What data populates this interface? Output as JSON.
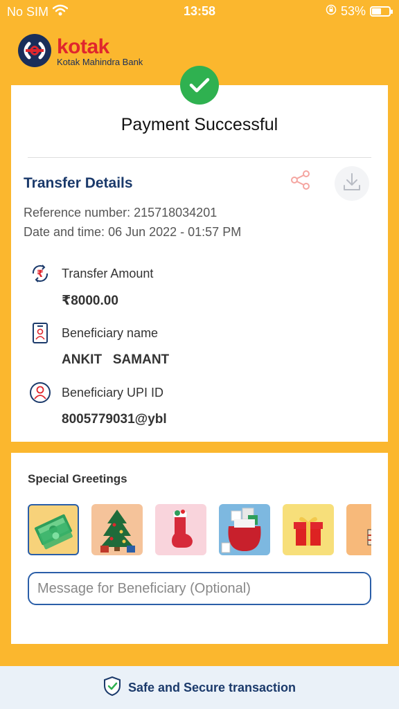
{
  "status": {
    "carrier": "No SIM",
    "time": "13:58",
    "battery": "53%",
    "battery_level": 0.53
  },
  "brand": {
    "name": "kotak",
    "subtitle": "Kotak Mahindra Bank",
    "color": "#E0262D"
  },
  "payment": {
    "status_title": "Payment Successful",
    "section_title": "Transfer Details",
    "reference": "Reference number: 215718034201",
    "datetime": "Date and time: 06 Jun 2022 - 01:57 PM",
    "details": [
      {
        "icon": "rupee-transfer-icon",
        "label": "Transfer Amount",
        "value": "₹8000.00"
      },
      {
        "icon": "id-card-icon",
        "label": "Beneficiary name",
        "value": "ANKIT   SAMANT"
      },
      {
        "icon": "user-circle-icon",
        "label": "Beneficiary UPI ID",
        "value": "8005779031@ybl"
      }
    ]
  },
  "greetings": {
    "title": "Special Greetings",
    "items": [
      "money-greeting-icon",
      "christmas-tree-icon",
      "stocking-icon",
      "gift-sack-icon",
      "gift-box-icon",
      "cake-icon"
    ],
    "message_placeholder": "Message for Beneficiary (Optional)"
  },
  "footer": {
    "text": "Safe and Secure transaction"
  },
  "colors": {
    "background": "#FBB72E",
    "success": "#2FB150",
    "primary": "#1B3A6B",
    "accent_blue": "#2A5EA8"
  }
}
